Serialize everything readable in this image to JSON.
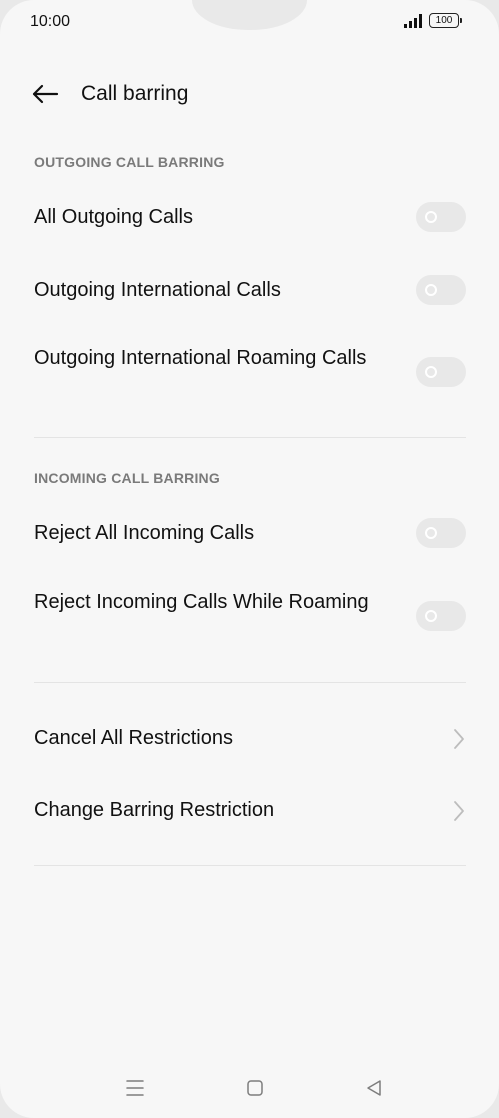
{
  "status_bar": {
    "time": "10:00",
    "battery": "100",
    "signal_icon": "signal-bars-icon"
  },
  "header": {
    "back_icon": "arrow-left-icon",
    "title": "Call barring"
  },
  "sections": {
    "outgoing": {
      "label": "OUTGOING CALL BARRING",
      "items": [
        {
          "label": "All Outgoing Calls",
          "toggle_on": false
        },
        {
          "label": "Outgoing International Calls",
          "toggle_on": false
        },
        {
          "label": "Outgoing International Roaming Calls",
          "toggle_on": false
        }
      ]
    },
    "incoming": {
      "label": "INCOMING CALL BARRING",
      "items": [
        {
          "label": "Reject All Incoming Calls",
          "toggle_on": false
        },
        {
          "label": "Reject Incoming Calls While Roaming",
          "toggle_on": false
        }
      ]
    },
    "actions": {
      "items": [
        {
          "label": "Cancel All Restrictions",
          "icon": "chevron-right-icon"
        },
        {
          "label": "Change Barring Restriction",
          "icon": "chevron-right-icon"
        }
      ]
    }
  },
  "nav_bar": {
    "menu_icon": "menu-icon",
    "home_icon": "home-square-icon",
    "back_icon": "back-triangle-icon"
  },
  "colors": {
    "background": "#f7f7f7",
    "toggle_off": "#e8e8e8",
    "section_label": "#7a7a7a",
    "text": "#111111"
  }
}
